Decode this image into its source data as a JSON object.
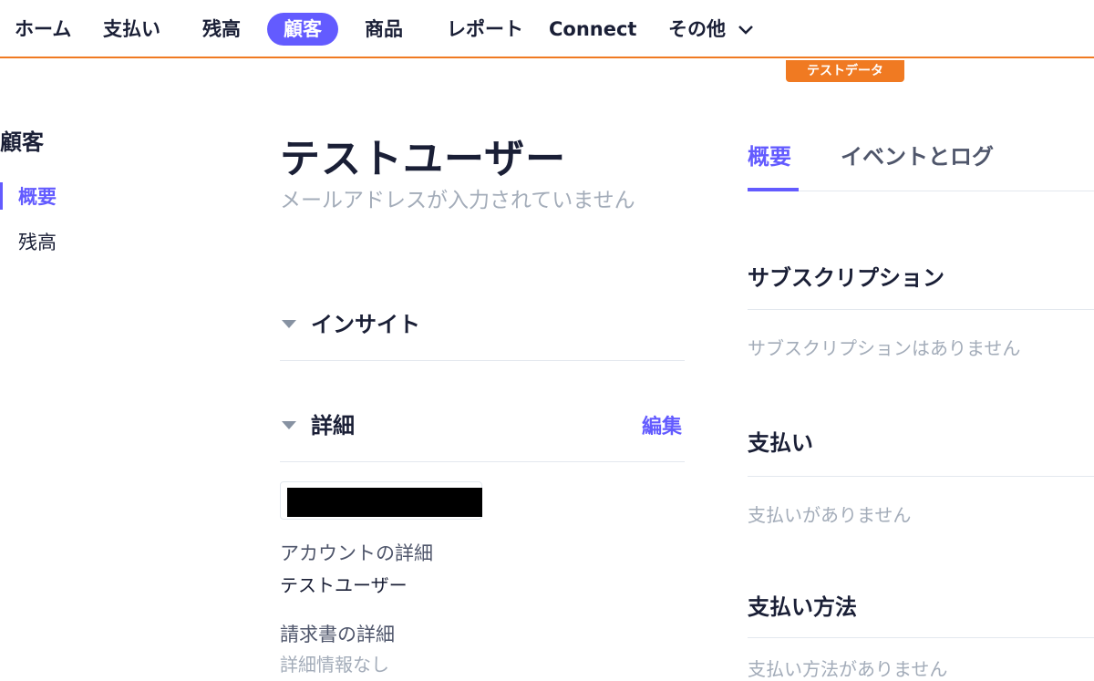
{
  "nav": {
    "items": [
      "ホーム",
      "支払い",
      "残高",
      "顧客",
      "商品",
      "レポート",
      "Connect",
      "その他"
    ],
    "active_index": 3
  },
  "test_badge": "テストデータ",
  "sidebar": {
    "title": "顧客",
    "items": [
      {
        "label": "概要",
        "active": true
      },
      {
        "label": "残高",
        "active": false
      }
    ]
  },
  "customer": {
    "name": "テストユーザー",
    "email_placeholder": "メールアドレスが入力されていません"
  },
  "sections": {
    "insight": "インサイト",
    "details": "詳細",
    "edit": "編集"
  },
  "details": {
    "account_label": "アカウントの詳細",
    "account_value": "テストユーザー",
    "invoice_label": "請求書の詳細",
    "invoice_value": "詳細情報なし"
  },
  "tabs": [
    "概要",
    "イベントとログ"
  ],
  "right": {
    "subscription_title": "サブスクリプション",
    "subscription_empty": "サブスクリプションはありません",
    "payments_title": "支払い",
    "payments_empty": "支払いがありません",
    "payment_methods_title": "支払い方法",
    "payment_methods_empty": "支払い方法がありません"
  },
  "colors": {
    "accent": "#635bff",
    "test_orange": "#f07a22",
    "muted": "#a3acb9"
  }
}
